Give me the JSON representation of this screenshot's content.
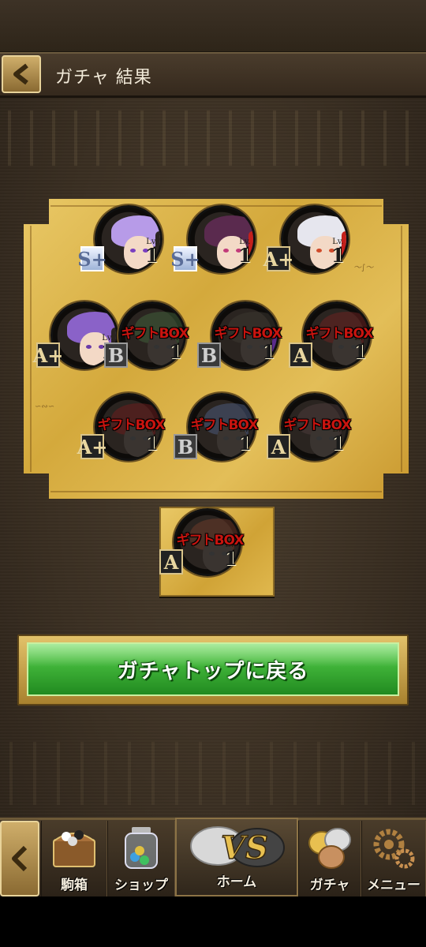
{
  "header": {
    "title": "ガチャ 結果"
  },
  "results": [
    {
      "grade": "S+",
      "level_label": "Lv.",
      "level": "1",
      "gift": "",
      "hair": "#b79be8",
      "eye": "#7a3fc0",
      "accent": "#2a2420"
    },
    {
      "grade": "S+",
      "level_label": "Lv.",
      "level": "1",
      "gift": "",
      "hair": "#5a2a4e",
      "eye": "#c23a7a",
      "accent": "#c4201c"
    },
    {
      "grade": "A+",
      "level_label": "Lv.",
      "level": "1",
      "gift": "",
      "hair": "#e6e6ee",
      "eye": "#d04a2a",
      "accent": "#c4201c"
    },
    {
      "grade": "A+",
      "level_label": "Lv.",
      "level": "1",
      "gift": "",
      "hair": "#8a62c8",
      "eye": "#6a3aa8",
      "accent": "#2a2420"
    },
    {
      "grade": "B",
      "level_label": "Lv.",
      "level": "1",
      "gift": "ギフトBOX",
      "hair": "#3f5e3a",
      "eye": "#333",
      "accent": "#2a2420"
    },
    {
      "grade": "B",
      "level_label": "Lv.",
      "level": "1",
      "gift": "ギフトBOX",
      "hair": "#3a3630",
      "eye": "#333",
      "accent": "#5a2a8a"
    },
    {
      "grade": "A",
      "level_label": "Lv.",
      "level": "1",
      "gift": "ギフトBOX",
      "hair": "#6a2220",
      "eye": "#333",
      "accent": "#2a2420"
    },
    {
      "grade": "A+",
      "level_label": "Lv.",
      "level": "1",
      "gift": "ギフトBOX",
      "hair": "#6a1e1e",
      "eye": "#333",
      "accent": "#2a2420"
    },
    {
      "grade": "B",
      "level_label": "Lv.",
      "level": "1",
      "gift": "ギフトBOX",
      "hair": "#4a5a7a",
      "eye": "#333",
      "accent": "#2a2420"
    },
    {
      "grade": "A",
      "level_label": "Lv.",
      "level": "1",
      "gift": "ギフトBOX",
      "hair": "#4a3a3a",
      "eye": "#333",
      "accent": "#2a2420"
    }
  ],
  "bonus": {
    "grade": "A",
    "level_label": "Lv.",
    "level": "1",
    "gift": "ギフトBOX",
    "hair": "#6a3a2a",
    "eye": "#333",
    "accent": "#2a2420"
  },
  "cta": {
    "label": "ガチャトップに戻る"
  },
  "nav": {
    "items": [
      {
        "label": "駒箱",
        "icon": "chest-icon"
      },
      {
        "label": "ショップ",
        "icon": "coin-jar-icon"
      },
      {
        "label": "ホーム",
        "icon": "vs-coins-icon"
      },
      {
        "label": "ガチャ",
        "icon": "coins-icon"
      },
      {
        "label": "メニュー",
        "icon": "gears-icon"
      }
    ]
  },
  "colors": {
    "gold": "#d4a93c",
    "green": "#3fb238",
    "gift_red": "#c8140f"
  }
}
